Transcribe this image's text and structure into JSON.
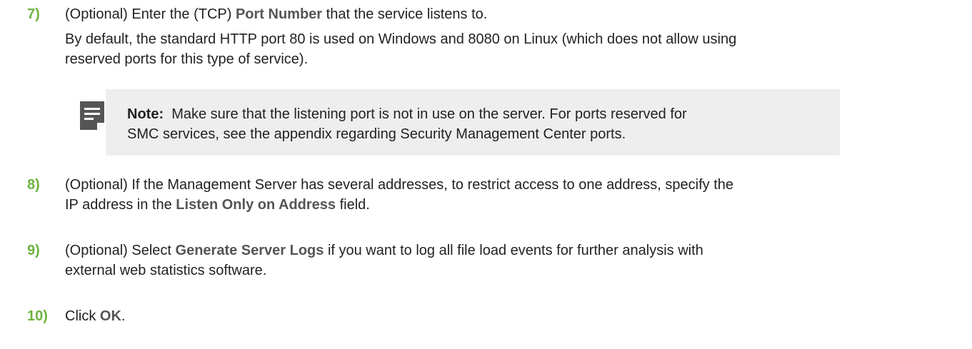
{
  "colors": {
    "step_number": "#6db33f",
    "ui_term": "#555555",
    "note_background": "#eeeeee",
    "note_icon": "#555555"
  },
  "steps": [
    {
      "number": "7)",
      "text_before": "(Optional) Enter the (TCP) ",
      "term": "Port Number",
      "text_after": " that the service listens to.",
      "detail_line1": "By default, the standard HTTP port 80 is used on Windows and 8080 on Linux (which does not allow using",
      "detail_line2": "reserved ports for this type of service)."
    },
    {
      "number": "8)",
      "line1": "(Optional) If the Management Server has several addresses, to restrict access to one address, specify the",
      "line2_before": "IP address in the ",
      "term": "Listen Only on Address",
      "line2_after": " field."
    },
    {
      "number": "9)",
      "line1_before": "(Optional) Select ",
      "term": "Generate Server Logs",
      "line1_after": " if you want to log all file load events for further analysis with",
      "line2": "external web statistics software."
    },
    {
      "number": "10)",
      "text_before": "Click ",
      "term": "OK",
      "text_after": "."
    }
  ],
  "note": {
    "icon": "note-icon",
    "label": "Note:",
    "line1": "  Make sure that the listening port is not in use on the server. For ports reserved for",
    "line2": "SMC services, see the appendix regarding Security Management Center ports."
  }
}
